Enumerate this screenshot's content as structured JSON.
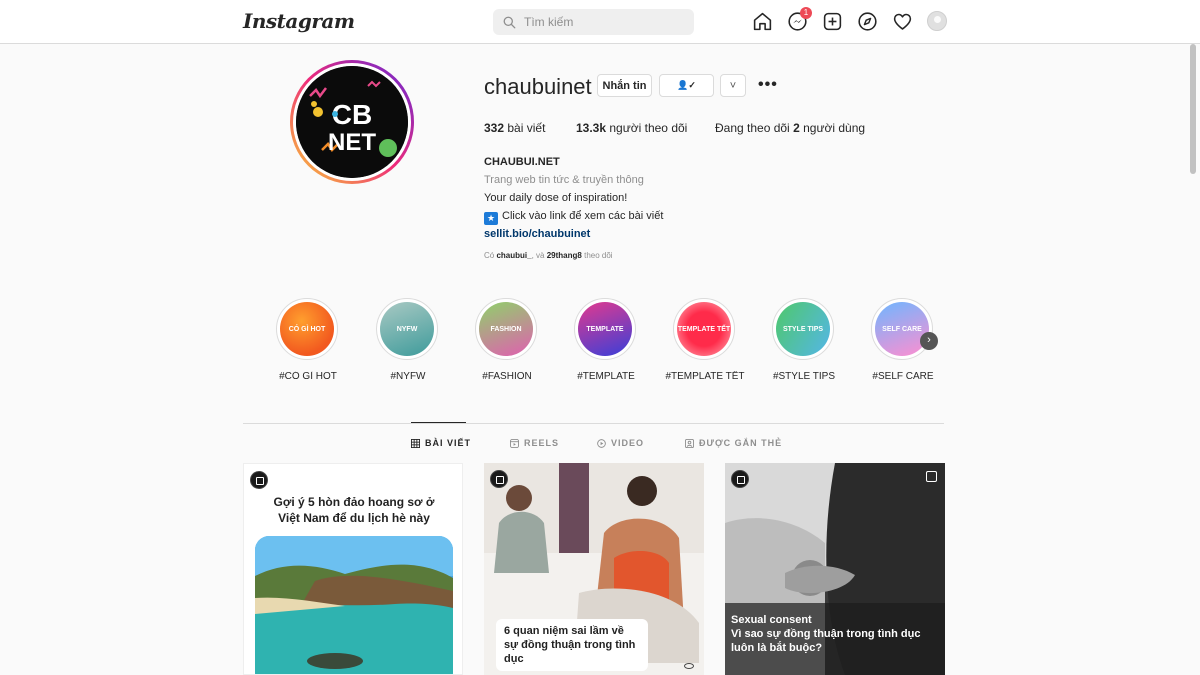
{
  "nav": {
    "logo": "Instagram",
    "search_placeholder": "Tìm kiếm",
    "notification_count": "1",
    "icons": [
      "home-icon",
      "messenger-icon",
      "new-post-icon",
      "explore-icon",
      "activity-heart-icon",
      "profile-avatar"
    ]
  },
  "profile": {
    "username": "chaubuinet",
    "message_button": "Nhắn tin",
    "follow_icon_label": "👤✓",
    "dropdown_icon": "˅",
    "more": "•••",
    "avatar_text_line1": "CB",
    "avatar_text_line2": "NET",
    "posts_count": "332",
    "posts_label": "bài viết",
    "followers_count": "13.3k",
    "followers_label": "người theo dõi",
    "following_prefix": "Đang theo dõi",
    "following_count": "2",
    "following_suffix": "người dùng",
    "display_name": "CHAUBUI.NET",
    "category": "Trang web tin tức & truyền thông",
    "bio_line1": "Your daily dose of inspiration!",
    "bio_star": "★",
    "bio_line2": "Click vào link để xem các bài viết",
    "link": "sellit.bio/chaubuinet",
    "followed_by_prefix": "Có",
    "followed_by_user1": "chaubui_",
    "followed_by_and": "và",
    "followed_by_user2": "29thang8",
    "followed_by_suffix": "theo dõi"
  },
  "highlights": [
    {
      "label": "#CÓ GÌ HOT",
      "cover": "CÓ GÌ HOT"
    },
    {
      "label": "#NYFW",
      "cover": "NYFW"
    },
    {
      "label": "#FASHION",
      "cover": "FASHION"
    },
    {
      "label": "#TEMPLATE",
      "cover": "TEMPLATE"
    },
    {
      "label": "#TEMPLATE TẾT",
      "cover": "TEMPLATE TẾT"
    },
    {
      "label": "#STYLE TIPS",
      "cover": "STYLE TIPS"
    },
    {
      "label": "#SELF CARE",
      "cover": "SELF CARE"
    }
  ],
  "tabs": [
    {
      "label": "BÀI VIẾT",
      "active": true
    },
    {
      "label": "REELS",
      "active": false
    },
    {
      "label": "VIDEO",
      "active": false
    },
    {
      "label": "ĐƯỢC GẮN THẺ",
      "active": false
    }
  ],
  "posts": [
    {
      "title": "Gợi ý 5 hòn đảo hoang sơ ở Việt Nam để du lịch hè này"
    },
    {
      "caption": "6 quan niệm sai lầm về sự đồng thuận trong tình dục"
    },
    {
      "caption_line1": "Sexual consent",
      "caption_line2": "Vì sao sự đồng thuận trong tình dục luôn là bắt buộc?"
    }
  ],
  "colors": {
    "accent_link": "#00376b",
    "notification_badge": "#ed4956",
    "border": "#dbdbdb"
  }
}
